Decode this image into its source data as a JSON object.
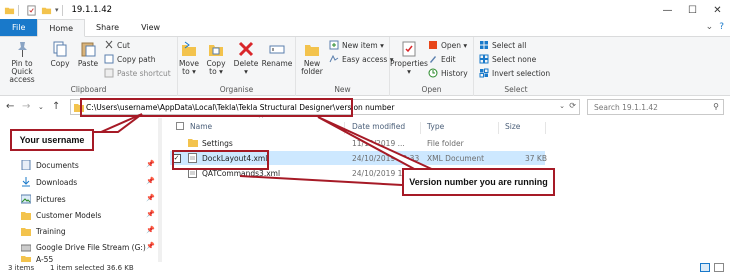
{
  "window": {
    "title": "19.1.1.42",
    "minimize": "—",
    "maximize": "☐",
    "close": "✕"
  },
  "ribbon_tabs": [
    {
      "label": "File"
    },
    {
      "label": "Home"
    },
    {
      "label": "Share"
    },
    {
      "label": "View"
    }
  ],
  "ribbon": {
    "clipboard": {
      "label": "Clipboard",
      "pin": "Pin to Quick\naccess",
      "copy": "Copy",
      "paste": "Paste",
      "cut": "Cut",
      "copy_path": "Copy path",
      "paste_shortcut": "Paste shortcut"
    },
    "organise": {
      "label": "Organise",
      "move_to": "Move\nto ▾",
      "copy_to": "Copy\nto ▾",
      "delete": "Delete\n▾",
      "rename": "Rename"
    },
    "new": {
      "label": "New",
      "new_folder": "New\nfolder",
      "new_item": "New item ▾",
      "easy_access": "Easy access ▾"
    },
    "open": {
      "label": "Open",
      "properties": "Properties\n▾",
      "open": "Open ▾",
      "edit": "Edit",
      "history": "History"
    },
    "select": {
      "label": "Select",
      "select_all": "Select all",
      "select_none": "Select none",
      "invert": "Invert selection"
    }
  },
  "address": {
    "path": "C:\\Users\\username\\AppData\\Local\\Tekla\\Tekla Structural Designer\\version number",
    "search_placeholder": "Search 19.1.1.42"
  },
  "nav_pane": {
    "items": [
      {
        "label": "Documents",
        "icon": "documents-icon",
        "pinned": true
      },
      {
        "label": "Downloads",
        "icon": "downloads-icon",
        "pinned": true
      },
      {
        "label": "Pictures",
        "icon": "pictures-icon",
        "pinned": true
      },
      {
        "label": "Customer Models",
        "icon": "folder-icon",
        "pinned": true
      },
      {
        "label": "Training",
        "icon": "folder-icon",
        "pinned": true
      },
      {
        "label": "Google Drive File Stream (G:)",
        "icon": "drive-icon",
        "pinned": true
      },
      {
        "label": "A-55",
        "icon": "folder-icon",
        "pinned": false
      }
    ]
  },
  "file_list": {
    "columns": [
      "Name",
      "Date modified",
      "Type",
      "Size"
    ],
    "rows": [
      {
        "name": "Settings",
        "date": "11/10/2019 ...",
        "type": "File folder",
        "size": "",
        "icon": "folder-icon",
        "selected": false
      },
      {
        "name": "DockLayout4.xml",
        "date": "24/10/2019 10:33",
        "type": "XML Document",
        "size": "37 KB",
        "icon": "xml-file-icon",
        "selected": true
      },
      {
        "name": "QATCommands3.xml",
        "date": "24/10/2019 10:33",
        "type": "",
        "size": "",
        "icon": "xml-file-icon",
        "selected": false
      }
    ]
  },
  "status": {
    "count": "3 items",
    "selection": "1 item selected  36.6 KB"
  },
  "callouts": {
    "username": "Your username",
    "version": "Version number you are running"
  },
  "colors": {
    "accent": "#1979ca",
    "callout_border": "#a61a26",
    "selection": "#cde8ff"
  }
}
